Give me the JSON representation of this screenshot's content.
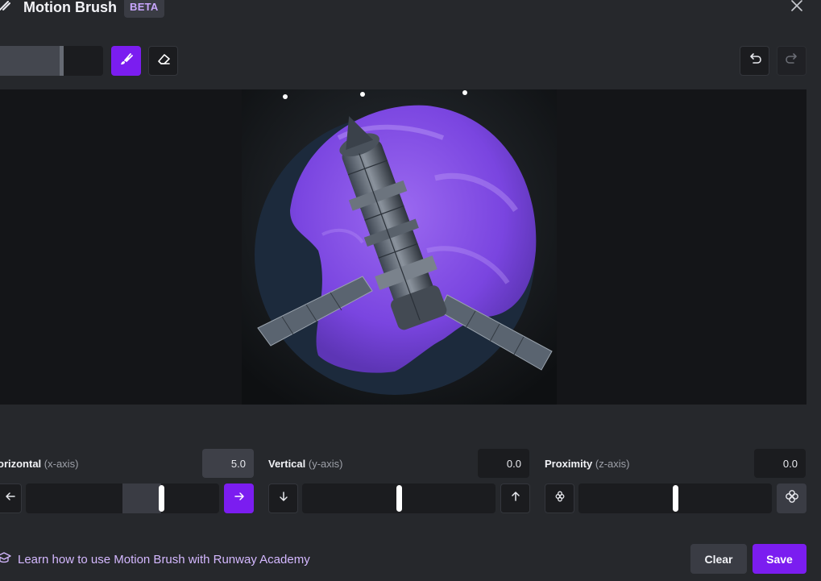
{
  "header": {
    "title": "Motion Brush",
    "badge": "BETA",
    "title_icon": "brush-icon",
    "close_icon": "close-icon"
  },
  "toolbar": {
    "brush_size_fraction": 0.62,
    "brush_icon": "brush-icon",
    "eraser_icon": "eraser-icon",
    "undo_icon": "undo-icon",
    "redo_icon": "redo-icon"
  },
  "canvas": {
    "image_icon": "space-station-image"
  },
  "axes": {
    "horizontal": {
      "label": "orizontal",
      "sub": "(x-axis)",
      "value": "5.0",
      "level": 0.7,
      "left_icon": "arrow-left-icon",
      "right_icon": "arrow-right-icon"
    },
    "vertical": {
      "label": "Vertical",
      "sub": "(y-axis)",
      "value": "0.0",
      "level": 0.5,
      "left_icon": "arrow-down-icon",
      "right_icon": "arrow-up-icon"
    },
    "proximity": {
      "label": "Proximity",
      "sub": "(z-axis)",
      "value": "0.0",
      "level": 0.5,
      "left_icon": "flower-small-icon",
      "right_icon": "flower-large-icon"
    }
  },
  "footer": {
    "learn_text": "Learn how to use Motion Brush with Runway Academy",
    "learn_icon": "graduation-cap-icon",
    "clear_label": "Clear",
    "save_label": "Save"
  },
  "colors": {
    "accent": "#7b1df0",
    "background": "#26282c",
    "link": "#d4b8ff"
  }
}
